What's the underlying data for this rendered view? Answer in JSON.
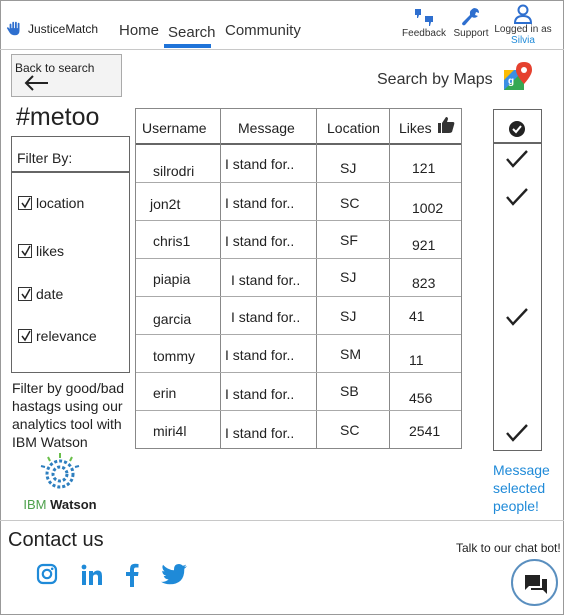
{
  "header": {
    "app_name": "JusticeMatch",
    "nav": {
      "home": "Home",
      "search": "Search",
      "community": "Community"
    },
    "feedback": "Feedback",
    "support": "Support",
    "logged_in": "Logged in as",
    "user_name": "Silvia"
  },
  "back": {
    "label": "Back to search"
  },
  "maps": {
    "label": "Search by Maps"
  },
  "hashtag": "#metoo",
  "filter": {
    "title": "Filter By:",
    "options": [
      "location",
      "likes",
      "date",
      "relevance"
    ],
    "note": "Filter by good/bad hastags using our analytics tool with IBM Watson",
    "watson_ibm": "IBM",
    "watson_name": "Watson"
  },
  "table": {
    "headers": {
      "username": "Username",
      "message": "Message",
      "location": "Location",
      "likes": "Likes"
    },
    "rows": [
      {
        "username": "silrodri",
        "message": "I stand for..",
        "location": "SJ",
        "likes": "121",
        "selected": true
      },
      {
        "username": "jon2t",
        "message": "I stand for..",
        "location": "SC",
        "likes": "1002",
        "selected": true
      },
      {
        "username": "chris1",
        "message": "I stand for..",
        "location": "SF",
        "likes": "921",
        "selected": false
      },
      {
        "username": "piapia",
        "message": "I stand for..",
        "location": "SJ",
        "likes": "823",
        "selected": false
      },
      {
        "username": "garcia",
        "message": "I stand for..",
        "location": "SJ",
        "likes": "41",
        "selected": true
      },
      {
        "username": "tommy",
        "message": "I stand for..",
        "location": "SM",
        "likes": "11",
        "selected": false
      },
      {
        "username": "erin",
        "message": "I stand for..",
        "location": "SB",
        "likes": "456",
        "selected": false
      },
      {
        "username": "miri4l",
        "message": "I stand for..",
        "location": "SC",
        "likes": "2541",
        "selected": true
      }
    ]
  },
  "message_selected": "Message selected people!",
  "footer": {
    "contact": "Contact us",
    "chatbot": "Talk to our chat bot!",
    "social": [
      "instagram-icon",
      "linkedin-icon",
      "facebook-icon",
      "twitter-icon"
    ]
  },
  "colors": {
    "accent": "#1f73d8",
    "link": "#1f8ad8",
    "header_icon": "#2e6fcf"
  }
}
